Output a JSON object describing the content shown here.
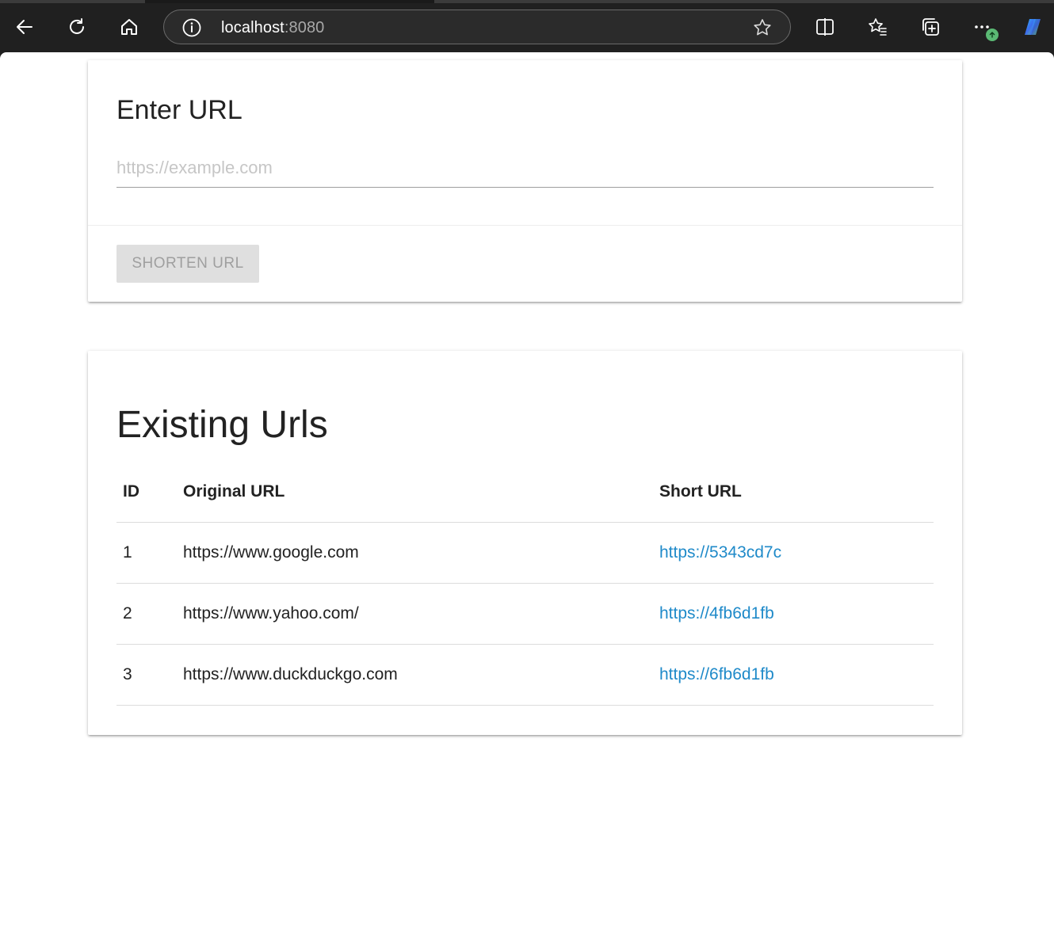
{
  "browser": {
    "address": {
      "host": "localhost",
      "port": ":8080"
    },
    "icons": {
      "back": "back-arrow-icon",
      "refresh": "refresh-icon",
      "home": "home-icon",
      "info": "info-icon",
      "favorite": "star-icon",
      "split": "split-screen-icon",
      "favorites": "favorites-icon",
      "collections": "collections-icon",
      "more": "more-icon",
      "copilot": "copilot-icon"
    }
  },
  "form": {
    "title": "Enter URL",
    "input_placeholder": "https://example.com",
    "input_value": "",
    "button_label": "SHORTEN URL"
  },
  "urls": {
    "title": "Existing Urls",
    "headers": [
      "ID",
      "Original URL",
      "Short URL"
    ],
    "rows": [
      {
        "id": "1",
        "original": "https://www.google.com",
        "short": "https://5343cd7c"
      },
      {
        "id": "2",
        "original": "https://www.yahoo.com/",
        "short": "https://4fb6d1fb"
      },
      {
        "id": "3",
        "original": "https://www.duckduckgo.com",
        "short": "https://6fb6d1fb"
      }
    ]
  },
  "colors": {
    "link": "#1f8ac9",
    "chrome_bg": "#202020",
    "disabled_button_bg": "#dfdfdf"
  }
}
